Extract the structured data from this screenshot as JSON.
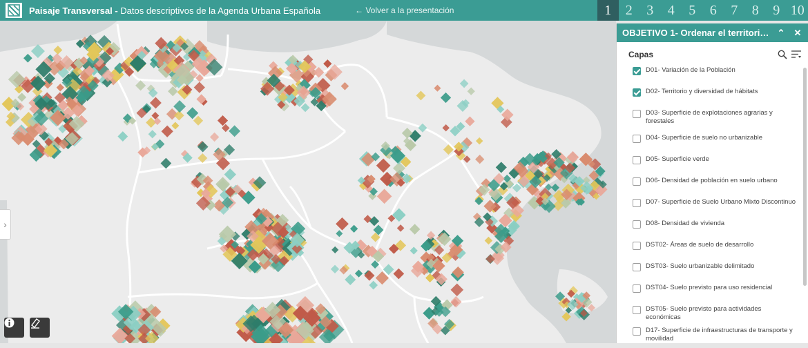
{
  "header": {
    "title_bold": "Paisaje Transversal -",
    "title_rest": " Datos descriptivos de la Agenda Urbana Española",
    "back_link": "← Volver a la presentación",
    "pages": [
      "1",
      "2",
      "3",
      "4",
      "5",
      "6",
      "7",
      "8",
      "9",
      "10"
    ],
    "active_page": "1"
  },
  "panel": {
    "title": "OBJETIVO 1- Ordenar el territorio...",
    "capas_label": "Capas",
    "layers": [
      {
        "label": "D01- Variación de la Población",
        "checked": true
      },
      {
        "label": "D02- Territorio y diversidad de hábitats",
        "checked": true
      },
      {
        "label": "D03- Superficie de explotaciones agrarias y forestales",
        "checked": false
      },
      {
        "label": "D04- Superficie de suelo no urbanizable",
        "checked": false
      },
      {
        "label": "D05- Superficie verde",
        "checked": false
      },
      {
        "label": "D06- Densidad de población en suelo urbano",
        "checked": false
      },
      {
        "label": "D07- Superficie de Suelo Urbano Mixto Discontinuo",
        "checked": false
      },
      {
        "label": "D08- Densidad de vivienda",
        "checked": false
      },
      {
        "label": "DST02- Áreas de suelo de desarrollo",
        "checked": false
      },
      {
        "label": "DST03- Suelo urbanizable delimitado",
        "checked": false
      },
      {
        "label": "DST04- Suelo previsto para uso residencial",
        "checked": false
      },
      {
        "label": "DST05- Suelo previsto para actividades económicas",
        "checked": false
      },
      {
        "label": "D17- Superficie de infraestructuras de transporte y movilidad",
        "checked": false
      }
    ]
  },
  "map": {
    "palette": [
      "#c05a48",
      "#3b9c8a",
      "#8ccfc4",
      "#e3c65a",
      "#e9a89a",
      "#2e7d6a",
      "#d98c6f",
      "#b9c9a9"
    ]
  },
  "colors": {
    "accent": "#3b9c94",
    "page_active": "#2f5f60",
    "sea": "#d5d8d9",
    "land": "#ececec"
  }
}
